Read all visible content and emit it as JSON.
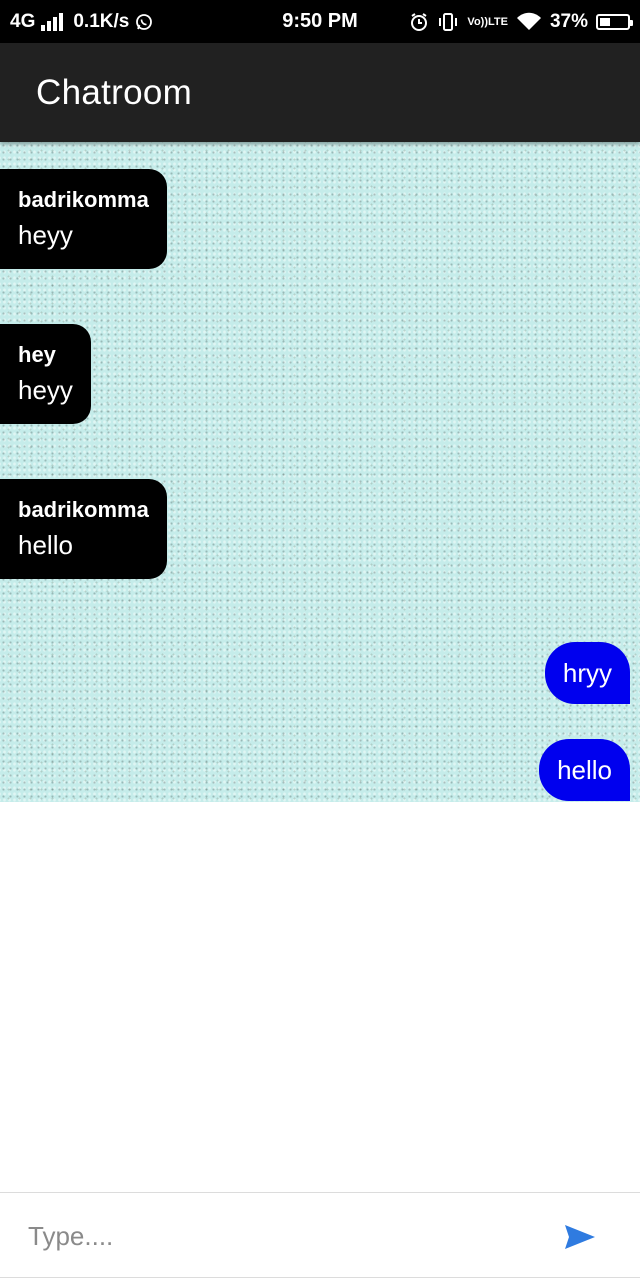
{
  "status_bar": {
    "network": "4G",
    "speed": "0.1K/s",
    "time": "9:50 PM",
    "volte_top": "Vo))",
    "volte_bottom": "LTE",
    "battery": "37%",
    "battery_level": 0.37,
    "icons": [
      "signal-icon",
      "whatsapp-icon",
      "alarm-icon",
      "vibrate-icon",
      "volte-icon",
      "wifi-icon",
      "battery-icon"
    ]
  },
  "app_bar": {
    "title": "Chatroom",
    "background": "#212121"
  },
  "chat": {
    "background": "#c5ecea",
    "incoming_color": "#000000",
    "outgoing_color": "#0000ee",
    "messages": [
      {
        "direction": "incoming",
        "sender": "badrikomma",
        "text": "heyy"
      },
      {
        "direction": "incoming",
        "sender": "hey",
        "text": "heyy"
      },
      {
        "direction": "incoming",
        "sender": "badrikomma",
        "text": "hello"
      },
      {
        "direction": "outgoing",
        "text": "hryy"
      },
      {
        "direction": "outgoing",
        "text": "hello"
      }
    ]
  },
  "composer": {
    "placeholder": "Type....",
    "value": "",
    "send_icon": "send-icon",
    "send_color": "#2f7be0"
  }
}
